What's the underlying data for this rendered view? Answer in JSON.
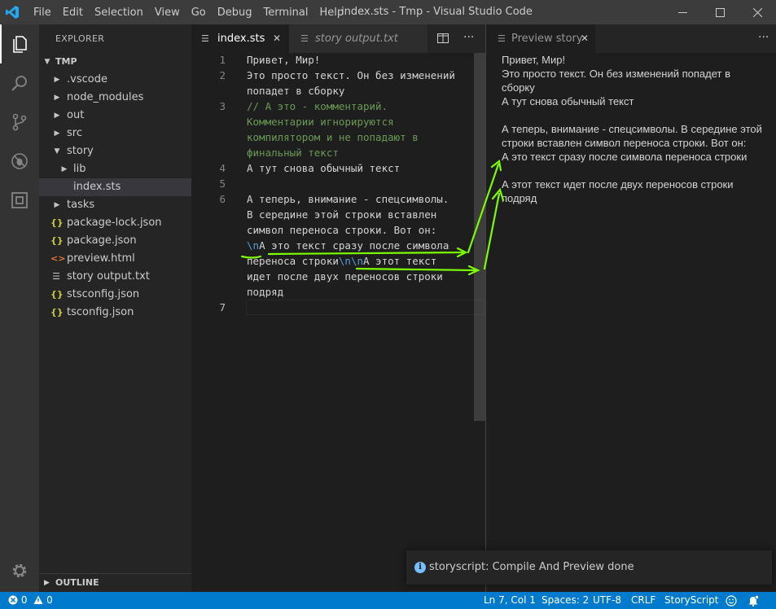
{
  "window": {
    "title": "index.sts - Tmp - Visual Studio Code",
    "menu": [
      "File",
      "Edit",
      "Selection",
      "View",
      "Go",
      "Debug",
      "Terminal",
      "Help"
    ]
  },
  "sidebar": {
    "header": "EXPLORER",
    "root": "TMP",
    "items": [
      {
        "label": ".vscode",
        "type": "folder-collapsed"
      },
      {
        "label": "node_modules",
        "type": "folder-collapsed"
      },
      {
        "label": "out",
        "type": "folder-collapsed"
      },
      {
        "label": "src",
        "type": "folder-collapsed"
      },
      {
        "label": "story",
        "type": "folder-expanded"
      },
      {
        "label": "lib",
        "type": "folder-collapsed"
      },
      {
        "label": "index.sts",
        "type": "file"
      },
      {
        "label": "tasks",
        "type": "folder-collapsed"
      },
      {
        "label": "package-lock.json",
        "type": "json"
      },
      {
        "label": "package.json",
        "type": "json"
      },
      {
        "label": "preview.html",
        "type": "html"
      },
      {
        "label": "story output.txt",
        "type": "text"
      },
      {
        "label": "stsconfig.json",
        "type": "json"
      },
      {
        "label": "tsconfig.json",
        "type": "json"
      }
    ],
    "outline": "OUTLINE"
  },
  "editor": {
    "tabs": [
      {
        "label": "index.sts",
        "active": true
      },
      {
        "label": "story output.txt",
        "active": false
      }
    ],
    "line_numbers": [
      "1",
      "2",
      "3",
      "4",
      "5",
      "6",
      "7"
    ],
    "lines": {
      "l1": "Привет, Мир!",
      "l2a": "Это просто текст. Он без изменений",
      "l2b": "попадет в сборку",
      "l3a": "// А это - комментарий.",
      "l3b": "Комментарии игнорируются",
      "l3c": "компилятором и не попадают в",
      "l3d": "финальный текст",
      "l4": "А тут снова обычный текст",
      "l6a": "А теперь, внимание - спецсимволы.",
      "l6b": "В середине этой строки вставлен",
      "l6c": "символ переноса строки. Вот он:",
      "l6d_esc": "\\n",
      "l6d_text": "А это текст сразу после символа",
      "l6e_text": "переноса строки",
      "l6e_esc": "\\n\\n",
      "l6e_text2": "А этот текст",
      "l6f": "идет после двух переносов строки",
      "l6g": "подряд"
    }
  },
  "preview": {
    "tab_label": "Preview story",
    "lines": [
      "Привет, Мир!",
      "Это просто текст. Он без изменений попадет в",
      "сборку",
      "А тут снова обычный текст",
      "",
      "А теперь, внимание - спецсимволы. В середине этой",
      "строки вставлен символ переноса строки. Вот он:",
      "А это текст сразу после символа переноса строки",
      "",
      "А этот текст идет после двух переносов строки",
      "подряд"
    ]
  },
  "notification": {
    "text": "storyscript: Compile And Preview done"
  },
  "status": {
    "errors": "0",
    "warnings": "0",
    "position": "Ln 7, Col 1",
    "spaces": "Spaces: 2",
    "encoding": "UTF-8",
    "eol": "CRLF",
    "language": "StoryScript"
  },
  "colors": {
    "statusbar": "#007acc",
    "annotation_arrow": "#7cfc00",
    "comment": "#6a9955",
    "escape": "#569cd6"
  }
}
